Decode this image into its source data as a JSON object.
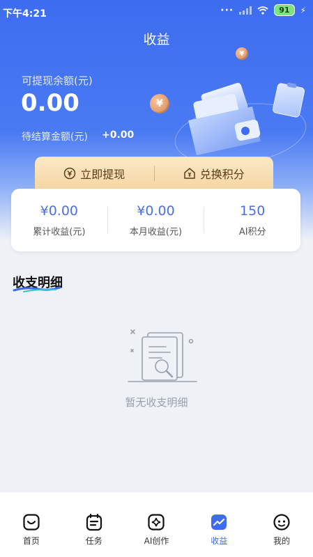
{
  "status_bar": {
    "time": "下午4:21",
    "battery": "91"
  },
  "header": {
    "title": "收益"
  },
  "balance": {
    "label": "可提现余额(元)",
    "value": "0.00",
    "pending_label": "待结算金额(元)",
    "pending_value": "+0.00"
  },
  "actions": {
    "withdraw": "立即提现",
    "exchange": "兑换积分"
  },
  "stats": [
    {
      "value": "¥0.00",
      "label": "累计收益(元)"
    },
    {
      "value": "¥0.00",
      "label": "本月收益(元)"
    },
    {
      "value": "150",
      "label": "AI积分"
    }
  ],
  "section": {
    "title": "收支明细",
    "empty_text": "暂无收支明细"
  },
  "tabbar": [
    {
      "label": "首页",
      "icon": "home-icon"
    },
    {
      "label": "任务",
      "icon": "task-icon"
    },
    {
      "label": "AI创作",
      "icon": "ai-create-icon"
    },
    {
      "label": "收益",
      "icon": "earnings-icon",
      "active": true
    },
    {
      "label": "我的",
      "icon": "profile-icon"
    }
  ],
  "colors": {
    "primary": "#3d6cf0",
    "accent_gold": "#f4d6a2",
    "stat_blue": "#4a6fe8"
  }
}
